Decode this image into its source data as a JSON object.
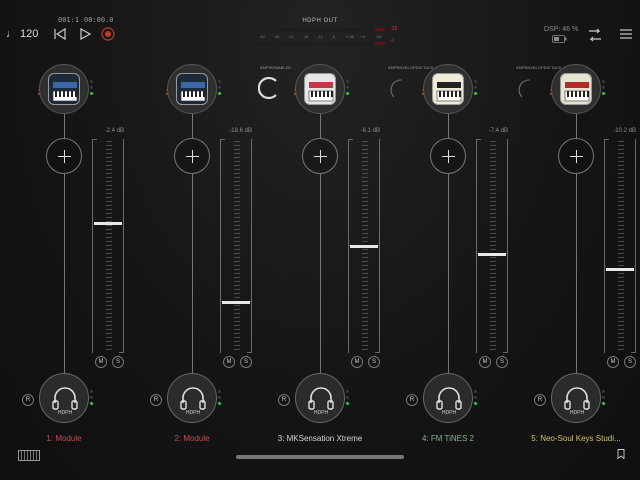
{
  "transport": {
    "tempo": "♩ 120",
    "bar_beat": "001:1",
    "time": "00:00.0",
    "icons": [
      "rewind-icon",
      "play-icon",
      "record-icon"
    ]
  },
  "output_meter": {
    "title": "HDPH OUT",
    "ticks": [
      "-60",
      "-36",
      "-24",
      "-18",
      "-12",
      "-6",
      "0 dB",
      "+6",
      "+12"
    ],
    "right_top": "-19",
    "right_bottom": "-1",
    "level_left": 0.0,
    "level_right": 0.0
  },
  "status": {
    "dsp": "DSP: 46 %",
    "battery": "▯⁡"
  },
  "accent": {
    "green": "#2ecc40",
    "red": "#c0392b",
    "channel_red": "#c05050",
    "channel_green": "#7fb77f",
    "channel_yellow": "#d6c070"
  },
  "channels": [
    {
      "name": "1: Module",
      "name_color": "#c05050",
      "db": "-2.4 dB",
      "fader": 0.62,
      "icon": "synth-module-icon",
      "output": "HDPH"
    },
    {
      "name": "2: Module",
      "name_color": "#c05050",
      "db": "-18.6 dB",
      "fader": 0.24,
      "icon": "synth-module-icon",
      "output": "HDPH"
    },
    {
      "name": "3: MKSensation Xtreme",
      "name_color": "#d8d8d8",
      "db": "-6.1 dB",
      "fader": 0.51,
      "icon": "synth-keys-icon",
      "output": "HDPH"
    },
    {
      "name": "4: FM TiNES 2",
      "name_color": "#7fb77f",
      "db": "-7.4 dB",
      "fader": 0.47,
      "icon": "fm-piano-icon",
      "output": "HDPH"
    },
    {
      "name": "5: Neo-Soul Keys Studi...",
      "name_color": "#d6c070",
      "db": "-10.2 dB",
      "fader": 0.4,
      "icon": "soul-keys-icon",
      "output": "HDPH"
    }
  ],
  "params": [
    {
      "label": "AMPISENABLED"
    },
    {
      "label": "AMPENVELOPEATTACK"
    },
    {
      "label": "AMPENVELOPEATTACK"
    }
  ],
  "buttons": {
    "mute": "M",
    "solo": "S",
    "record": "R"
  }
}
